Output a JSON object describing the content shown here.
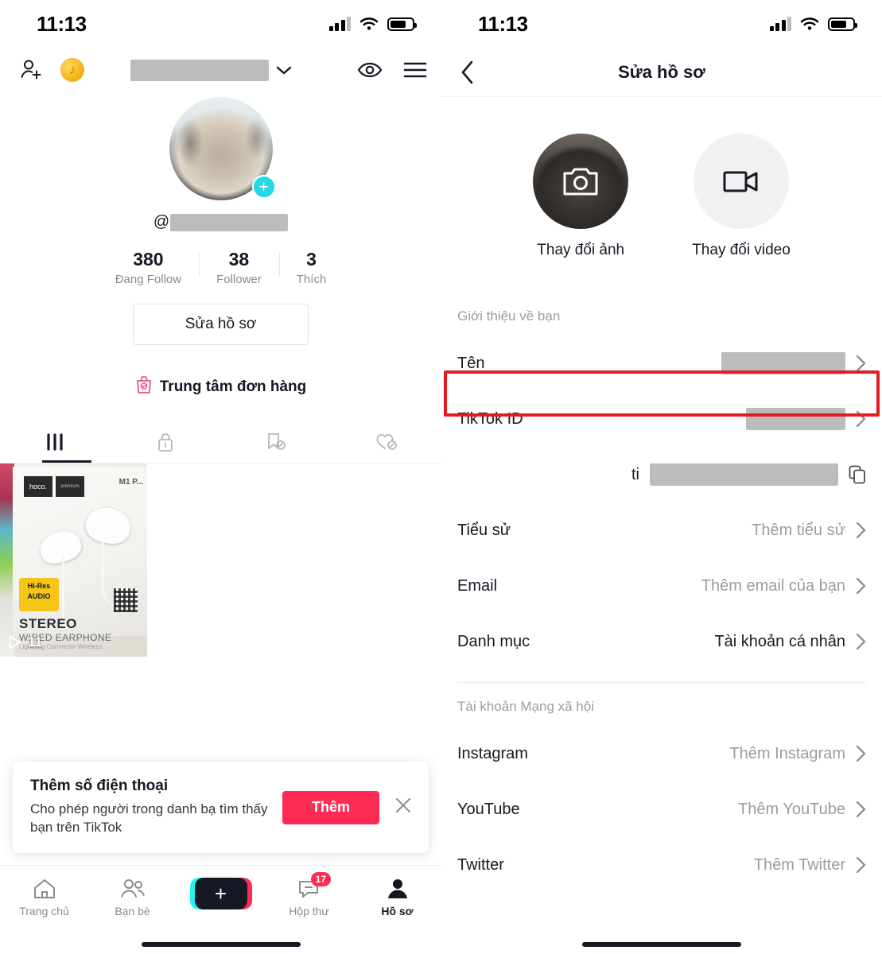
{
  "status_bar": {
    "time": "11:13"
  },
  "left_panel": {
    "header": {
      "add_user_icon": "add-person-icon",
      "coin_icon": "tiktok-coin-icon",
      "username_redacted": true,
      "dropdown_icon": "chevron-down-icon",
      "eye_icon": "eye-icon",
      "menu_icon": "hamburger-menu-icon"
    },
    "profile": {
      "avatar_add_icon": "plus-icon",
      "handle_prefix": "@",
      "handle_redacted": true,
      "stats": [
        {
          "value": "380",
          "label": "Đang Follow"
        },
        {
          "value": "38",
          "label": "Follower"
        },
        {
          "value": "3",
          "label": "Thích"
        }
      ],
      "edit_profile_label": "Sửa hồ sơ",
      "order_center_label": "Trung tâm đơn hàng",
      "order_center_icon": "shopping-bag-check-icon"
    },
    "tabs": [
      {
        "icon": "grid-posts-icon",
        "active": true
      },
      {
        "icon": "lock-private-icon",
        "active": false
      },
      {
        "icon": "bookmark-off-icon",
        "active": false
      },
      {
        "icon": "heart-off-icon",
        "active": false
      }
    ],
    "video": {
      "play_count": "11",
      "play_icon": "play-icon",
      "overlay_brand": "hoco.",
      "overlay_brand_2": "premium",
      "overlay_model": "M1 P...",
      "overlay_hires_top": "Hi-Res",
      "overlay_hires_bottom": "AUDIO",
      "overlay_stereo": "STEREO",
      "overlay_wired": "WIRED EARPHONE",
      "overlay_light": "Lightning Connector Wireless"
    },
    "banner": {
      "title": "Thêm số điện thoại",
      "subtitle": "Cho phép người trong danh bạ tìm thấy bạn trên TikTok",
      "cta_label": "Thêm",
      "close_icon": "close-icon"
    },
    "bottom_nav": [
      {
        "label": "Trang chủ",
        "icon": "home-icon",
        "active": false
      },
      {
        "label": "Bạn bè",
        "icon": "friends-icon",
        "active": false
      },
      {
        "label": "",
        "icon": "create-plus-icon",
        "active": false
      },
      {
        "label": "Hộp thư",
        "icon": "inbox-icon",
        "active": false,
        "badge": "17"
      },
      {
        "label": "Hồ sơ",
        "icon": "person-icon",
        "active": true
      }
    ]
  },
  "right_panel": {
    "header": {
      "back_icon": "chevron-left-icon",
      "title": "Sửa hồ sơ"
    },
    "media": [
      {
        "label": "Thay đổi ảnh",
        "icon": "camera-icon"
      },
      {
        "label": "Thay đổi video",
        "icon": "video-camera-icon"
      }
    ],
    "about_section_label": "Giới thiệu về bạn",
    "about_rows": [
      {
        "label": "Tên",
        "value": "",
        "redacted": true,
        "redact_width": 156,
        "chevron": true,
        "highlighted": true
      },
      {
        "label": "TikTok ID",
        "value": "",
        "redacted": true,
        "redact_width": 125,
        "chevron": true,
        "highlighted": false
      }
    ],
    "id_sub_row": {
      "prefix": "ti",
      "redacted": true,
      "redact_width": 237,
      "copy_icon": "copy-icon"
    },
    "detail_rows": [
      {
        "label": "Tiểu sử",
        "value": "Thêm tiểu sử",
        "muted": true
      },
      {
        "label": "Email",
        "value": "Thêm email của bạn",
        "muted": true
      },
      {
        "label": "Danh mục",
        "value": "Tài khoản cá nhân",
        "muted": false
      }
    ],
    "social_section_label": "Tài khoản Mạng xã hội",
    "social_rows": [
      {
        "label": "Instagram",
        "value": "Thêm Instagram",
        "muted": true
      },
      {
        "label": "YouTube",
        "value": "Thêm YouTube",
        "muted": true
      },
      {
        "label": "Twitter",
        "value": "Thêm Twitter",
        "muted": true
      }
    ]
  },
  "colors": {
    "accent_red": "#fe2c55",
    "highlight_red": "#e51b23",
    "cyan": "#25f4ee",
    "muted_text": "#9b9ca1",
    "redact_gray": "#bcbcbc"
  }
}
